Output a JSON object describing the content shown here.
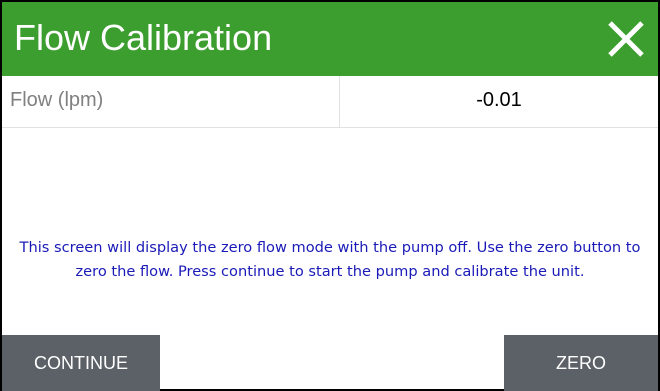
{
  "dialog": {
    "title": "Flow Calibration",
    "close_icon": "close-icon",
    "header_color": "#3c9e2f"
  },
  "readings": [
    {
      "label": "Flow (lpm)",
      "value": "-0.01"
    }
  ],
  "message": "This screen will display the zero flow mode with the pump off.  Use the zero button to zero the flow.  Press continue to start the pump and calibrate the unit.",
  "buttons": {
    "continue_label": "CONTINUE",
    "zero_label": "ZERO",
    "button_color": "#5b6166"
  }
}
